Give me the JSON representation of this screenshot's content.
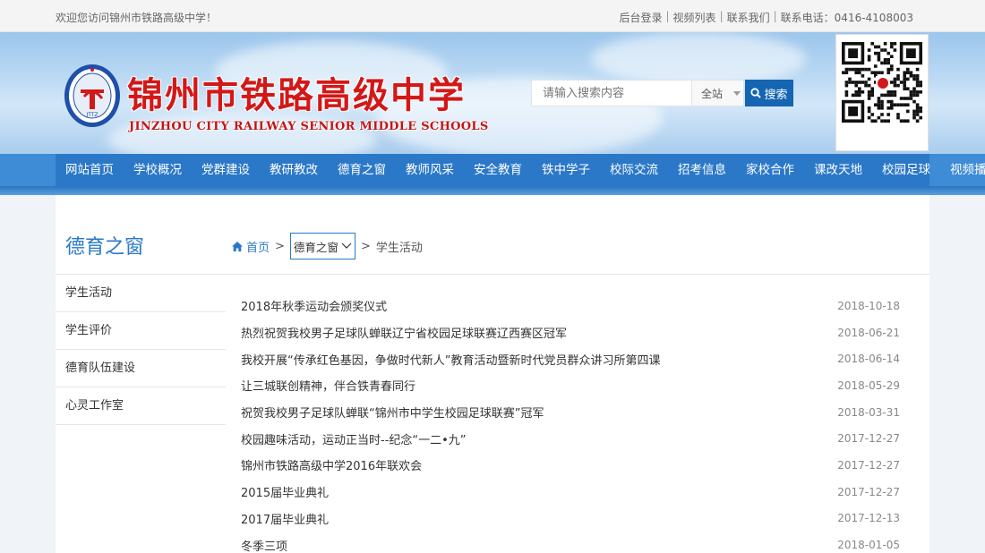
{
  "topbar": {
    "welcome": "欢迎您访问锦州市铁路高级中学！",
    "links": [
      "后台登录",
      "视频列表",
      "联系我们",
      "联系电话：0416-4108003"
    ]
  },
  "header": {
    "school_name_cn": "锦州市铁路高级中学",
    "school_name_en": "JINZHOU CITY RAILWAY SENIOR MIDDLE SCHOOLS",
    "logo_text": "JTTZ"
  },
  "search": {
    "placeholder": "请输入搜索内容",
    "scope": "全站",
    "button": "搜索"
  },
  "nav": [
    "网站首页",
    "学校概况",
    "党群建设",
    "教研教改",
    "德育之窗",
    "教师风采",
    "安全教育",
    "铁中学子",
    "校际交流",
    "招考信息",
    "家校合作",
    "课改天地",
    "校园足球",
    "视频播客"
  ],
  "sidebar": {
    "title": "德育之窗",
    "items": [
      "学生活动",
      "学生评价",
      "德育队伍建设",
      "心灵工作室"
    ]
  },
  "breadcrumb": {
    "home": "首页",
    "section": "德育之窗",
    "current": "学生活动"
  },
  "articles": [
    {
      "title": "2018年秋季运动会颁奖仪式",
      "date": "2018-10-18"
    },
    {
      "title": "热烈祝贺我校男子足球队蝉联辽宁省校园足球联赛辽西赛区冠军",
      "date": "2018-06-21"
    },
    {
      "title": "我校开展“传承红色基因，争做时代新人”教育活动暨新时代党员群众讲习所第四课",
      "date": "2018-06-14"
    },
    {
      "title": "让三城联创精神，伴合铁青春同行",
      "date": "2018-05-29"
    },
    {
      "title": "祝贺我校男子足球队蝉联“锦州市中学生校园足球联赛”冠军",
      "date": "2018-03-31"
    },
    {
      "title": "校园趣味活动，运动正当时--纪念“一二•九”",
      "date": "2017-12-27"
    },
    {
      "title": "锦州市铁路高级中学2016年联欢会",
      "date": "2017-12-27"
    },
    {
      "title": "2015届毕业典礼",
      "date": "2017-12-27"
    },
    {
      "title": "2017届毕业典礼",
      "date": "2017-12-13"
    },
    {
      "title": "冬季三项",
      "date": "2018-01-05"
    }
  ],
  "icons": {
    "search": "search-icon",
    "home": "home-icon",
    "dropdown": "chevron-down-icon",
    "qr": "qr-code-icon"
  },
  "colors": {
    "nav_blue": "#2b78c8",
    "accent_blue": "#2a78c6",
    "search_button": "#1465b2",
    "school_red": "#d21818"
  }
}
